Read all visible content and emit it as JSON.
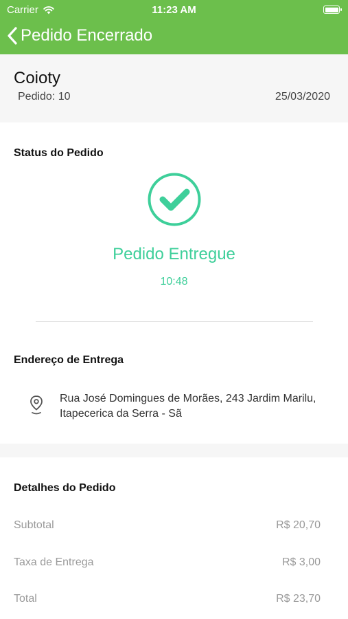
{
  "status_bar": {
    "carrier": "Carrier",
    "time": "11:23 AM",
    "battery_level": 1.0
  },
  "nav": {
    "title": "Pedido Encerrado"
  },
  "header": {
    "store_name": "Coioty",
    "order_number": "Pedido: 10",
    "date": "25/03/2020"
  },
  "status": {
    "section_title": "Status do Pedido",
    "state": "Pedido Entregue",
    "time": "10:48",
    "color": "#3ecf9a"
  },
  "delivery": {
    "section_title": "Endereço de Entrega",
    "address": "Rua José Domingues de Morães, 243 Jardim Marilu, Itapecerica da Serra - Sã"
  },
  "details": {
    "section_title": "Detalhes do Pedido",
    "rows": [
      {
        "label": "Subtotal",
        "value": "R$ 20,70"
      },
      {
        "label": "Taxa de Entrega",
        "value": "R$ 3,00"
      },
      {
        "label": "Total",
        "value": "R$ 23,70"
      }
    ]
  },
  "colors": {
    "brand": "#6cbf4c",
    "accent": "#3ecf9a"
  }
}
